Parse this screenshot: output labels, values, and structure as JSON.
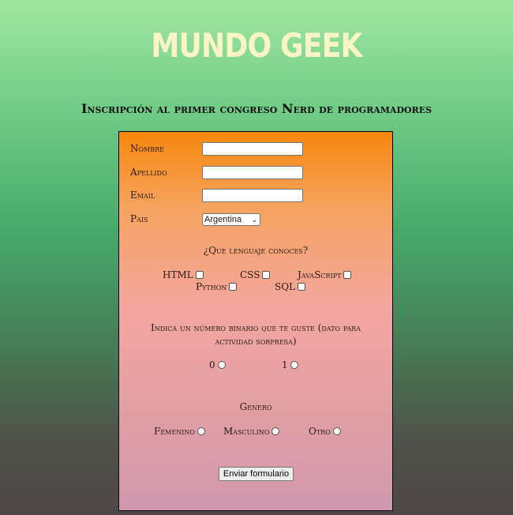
{
  "header": {
    "title": "MUNDO GEEK",
    "subtitle": "Inscripción al primer congreso Nerd de programadores"
  },
  "form": {
    "fields": {
      "nombre": {
        "label": "Nombre",
        "value": ""
      },
      "apellido": {
        "label": "Apellido",
        "value": ""
      },
      "email": {
        "label": "Email",
        "value": ""
      },
      "pais": {
        "label": "Pais",
        "selected": "Argentina"
      }
    },
    "languages": {
      "question": "¿Que lenguaje conoces?",
      "options": [
        "HTML",
        "CSS",
        "JavaScript",
        "Python",
        "SQL"
      ]
    },
    "binary": {
      "question": "Indica un número binario que te guste (dato para actividad sorpresa)",
      "options": [
        "0",
        "1"
      ]
    },
    "gender": {
      "title": "Genero",
      "options": [
        "Femenino",
        "Masculino",
        "Otro"
      ]
    },
    "submit_label": "Enviar formulario"
  },
  "colors": {
    "title": "#fdf4c6",
    "form_top": "#f7870c",
    "form_bottom": "#d098af"
  }
}
